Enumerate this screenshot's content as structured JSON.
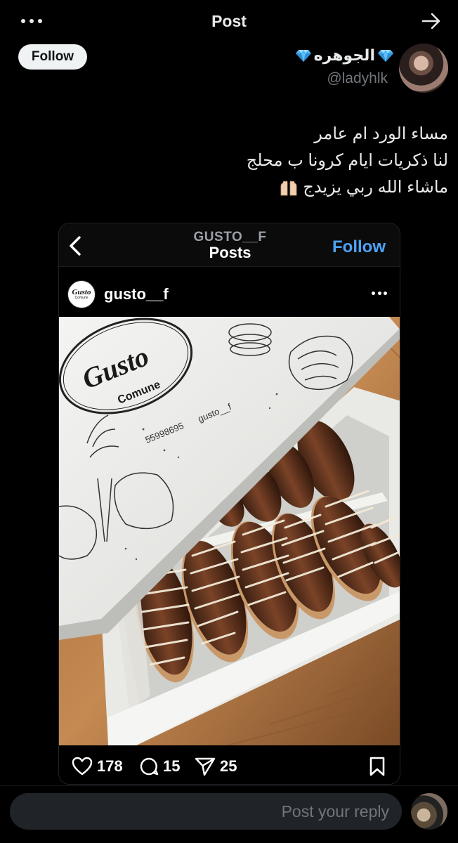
{
  "header": {
    "title": "Post",
    "more_icon": "more-horizontal-icon",
    "forward_icon": "arrow-right-icon"
  },
  "author": {
    "follow_label": "Follow",
    "display_name": "الجوهره",
    "handle": "@ladyhlk",
    "name_emoji": "diamond-icon"
  },
  "tweet": {
    "lines": [
      "مساء الورد ام عامر",
      "لنا ذكريات ايام كرونا ب محلج",
      "ماشاء الله ربي يزيدج"
    ],
    "trailing_emoji": "raised-hands-icon"
  },
  "embedded": {
    "header_username": "GUSTO__F",
    "header_title": "Posts",
    "header_follow": "Follow",
    "post_username": "gusto__f",
    "avatar_brand": "Gusto",
    "avatar_sub": "Comune",
    "photo": {
      "brand": "Gusto",
      "sub": "Comune",
      "phone": "55998695",
      "instagram": "gusto__f"
    },
    "likes": "178",
    "comments": "15",
    "shares": "25"
  },
  "reply": {
    "placeholder": "Post your reply"
  },
  "colors": {
    "background": "#000000",
    "text": "#e7e9ea",
    "secondary": "#71767b",
    "link_blue": "#4da3f8",
    "follow_bg": "#eff3f4"
  }
}
